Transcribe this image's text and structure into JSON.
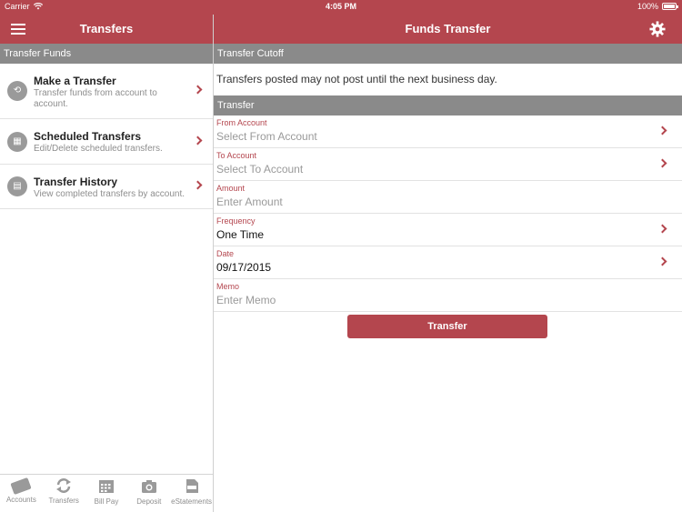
{
  "status": {
    "carrier": "Carrier",
    "time": "4:05 PM",
    "battery": "100%"
  },
  "left_nav": {
    "title": "Transfers",
    "menu_icon": "hamburger-icon"
  },
  "right_nav": {
    "title": "Funds Transfer",
    "settings_icon": "gear-icon"
  },
  "sidebar": {
    "section_title": "Transfer Funds",
    "items": [
      {
        "title": "Make a Transfer",
        "subtitle": "Transfer funds from account to account.",
        "icon": "transfer-arrows-icon"
      },
      {
        "title": "Scheduled Transfers",
        "subtitle": "Edit/Delete scheduled transfers.",
        "icon": "calendar-icon"
      },
      {
        "title": "Transfer History",
        "subtitle": "View completed transfers by account.",
        "icon": "document-icon"
      }
    ]
  },
  "tabbar": {
    "tabs": [
      {
        "label": "Accounts",
        "icon": "card-icon"
      },
      {
        "label": "Transfers",
        "icon": "transfer-arrows-icon"
      },
      {
        "label": "Bill Pay",
        "icon": "calendar-icon"
      },
      {
        "label": "Deposit",
        "icon": "camera-icon"
      },
      {
        "label": "eStatements",
        "icon": "pdf-icon"
      }
    ]
  },
  "main": {
    "cutoff_header": "Transfer Cutoff",
    "cutoff_text": "Transfers posted may not post until the next business day.",
    "transfer_header": "Transfer",
    "fields": [
      {
        "label": "From Account",
        "value": "Select From Account",
        "placeholder": true
      },
      {
        "label": "To Account",
        "value": "Select To Account",
        "placeholder": true
      },
      {
        "label": "Amount",
        "value": "Enter Amount",
        "placeholder": true
      },
      {
        "label": "Frequency",
        "value": "One Time",
        "placeholder": false
      },
      {
        "label": "Date",
        "value": "09/17/2015",
        "placeholder": false
      },
      {
        "label": "Memo",
        "value": "Enter Memo",
        "placeholder": true
      }
    ],
    "submit_label": "Transfer"
  },
  "colors": {
    "accent": "#b4464e",
    "section_header": "#8a8a8a"
  }
}
